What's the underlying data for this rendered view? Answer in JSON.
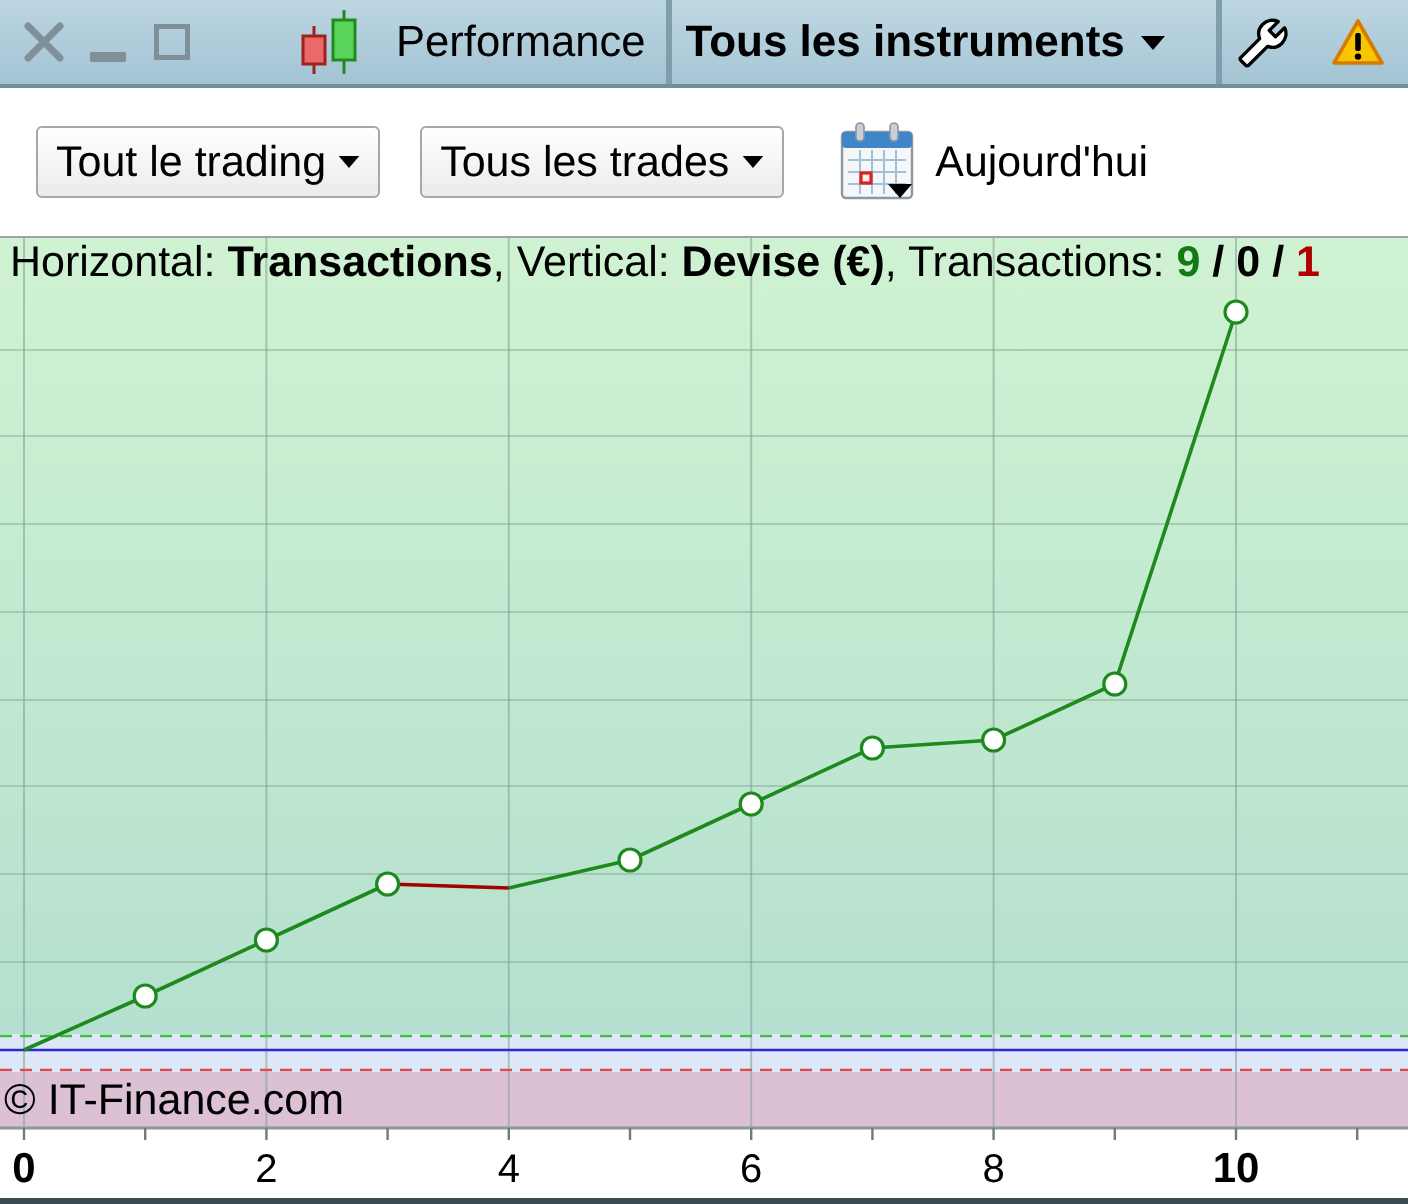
{
  "title_bar": {
    "title": "Performance",
    "instrument_menu": {
      "label": "Tous les instruments"
    }
  },
  "toolbar": {
    "dropdowns": [
      {
        "label": "Tout le trading"
      },
      {
        "label": "Tous les trades"
      }
    ],
    "date_filter": {
      "label": "Aujourd'hui"
    }
  },
  "chart": {
    "caption": "Horizontal: **Transactions**, Vertical: **Devise (€)**, Transactions:",
    "counts": [
      {
        "text": "9",
        "kind": "win"
      },
      {
        "text": "/",
        "kind": "separator"
      },
      {
        "text": "0",
        "kind": "neutral"
      },
      {
        "text": "/",
        "kind": "separator"
      },
      {
        "text": "1",
        "kind": "loss"
      }
    ],
    "trades": [
      {
        "kind": "win"
      },
      {
        "kind": "win"
      },
      {
        "kind": "win"
      },
      {
        "kind": "loss"
      },
      {
        "kind": "win"
      },
      {
        "kind": "win"
      },
      {
        "kind": "win"
      },
      {
        "kind": "win"
      },
      {
        "kind": "win"
      },
      {
        "kind": "win"
      }
    ],
    "credit": "© IT-Finance.com",
    "x_axis": {
      "tick_labels": [
        {
          "text": "0",
          "emphasized": true
        },
        {
          "text": "2",
          "emphasized": false
        },
        {
          "text": "4",
          "emphasized": false
        },
        {
          "text": "6",
          "emphasized": false
        },
        {
          "text": "8",
          "emphasized": false
        },
        {
          "text": "10",
          "emphasized": true
        }
      ]
    }
  }
}
